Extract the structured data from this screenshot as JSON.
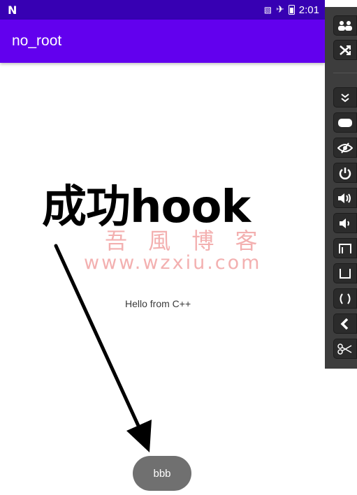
{
  "status_bar": {
    "logo": "N",
    "time": "2:01",
    "icons": [
      "no-sim-icon",
      "airplane-mode-icon",
      "battery-icon"
    ]
  },
  "app_bar": {
    "title": "no_root"
  },
  "annotation": {
    "text": "成功hook"
  },
  "watermark": {
    "chinese": "吾 風 博 客",
    "url": "www.wzxiu.com"
  },
  "content": {
    "hello_text": "Hello from C++"
  },
  "button": {
    "label": "bbb"
  },
  "toolbar": {
    "buttons": [
      {
        "name": "multi-display-icon",
        "glyph": "👥"
      },
      {
        "name": "shuffle-icon",
        "glyph": "⤨"
      },
      {
        "name": "collapse-icon",
        "glyph": "⌄"
      },
      {
        "name": "rounded-rect-icon",
        "glyph": "▬"
      },
      {
        "name": "eye-slash-icon",
        "glyph": "👁"
      },
      {
        "name": "power-icon",
        "glyph": "⏻"
      },
      {
        "name": "volume-up-icon",
        "glyph": "🔊"
      },
      {
        "name": "volume-down-icon",
        "glyph": "🔉"
      },
      {
        "name": "rotate-left-icon",
        "glyph": "⊓"
      },
      {
        "name": "home-icon",
        "glyph": "⊔"
      },
      {
        "name": "recents-icon",
        "glyph": "( )"
      },
      {
        "name": "back-icon",
        "glyph": "❮"
      },
      {
        "name": "scissors-icon",
        "glyph": "✂"
      }
    ]
  },
  "colors": {
    "status_bar": "#3700b3",
    "app_bar": "#6200ee",
    "button": "#707070",
    "watermark": "#f2a3a3"
  }
}
